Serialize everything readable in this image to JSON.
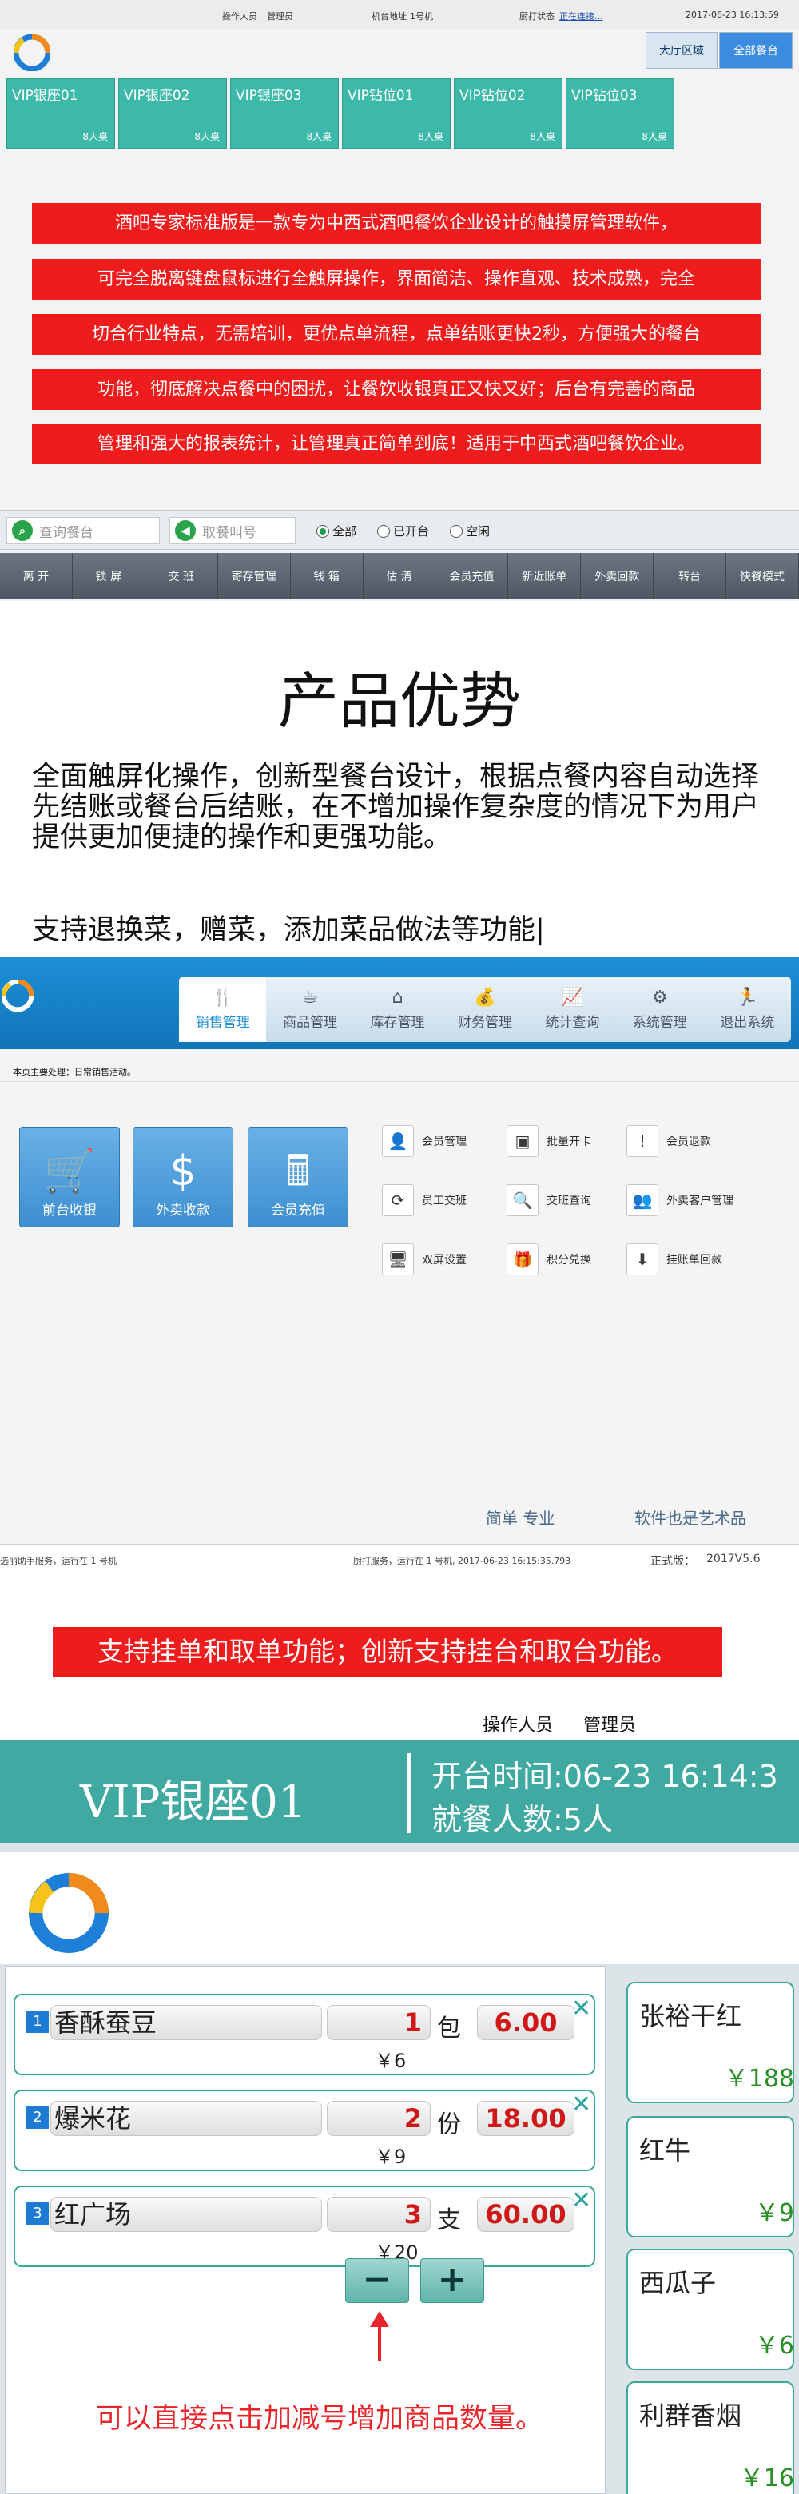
{
  "pos_screen": {
    "status": {
      "operator_label": "操作人员",
      "operator": "管理员",
      "ip_label": "机台地址",
      "ip": "1号机",
      "kitchen_label": "厨打状态",
      "kitchen_status": "正在连接...",
      "datetime": "2017-06-23 16:13:59"
    },
    "area_tabs": [
      "大厅区域",
      "全部餐台"
    ],
    "tables": [
      {
        "name": "VIP银座01",
        "seats": "8人桌"
      },
      {
        "name": "VIP银座02",
        "seats": "8人桌"
      },
      {
        "name": "VIP银座03",
        "seats": "8人桌"
      },
      {
        "name": "VIP钻位01",
        "seats": "8人桌"
      },
      {
        "name": "VIP钻位02",
        "seats": "8人桌"
      },
      {
        "name": "VIP钻位03",
        "seats": "8人桌"
      }
    ],
    "promo_lines": [
      "酒吧专家标准版是一款专为中西式酒吧餐饮企业设计的触摸屏管理软件，",
      "可完全脱离键盘鼠标进行全触屏操作，界面简洁、操作直观、技术成熟，完全",
      "切合行业特点，无需培训，更优点单流程，点单结账更快2秒，方便强大的餐台",
      "功能，彻底解决点餐中的困扰，让餐饮收银真正又快又好；后台有完善的商品",
      "管理和强大的报表统计，让管理真正简单到底！适用于中西式酒吧餐饮企业。"
    ],
    "search_placeholder": "查询餐台",
    "call_placeholder": "取餐叫号",
    "filters": [
      "全部",
      "已开台",
      "空闲"
    ],
    "selected_filter": "全部",
    "function_buttons": [
      "离 开",
      "锁 屏",
      "交 班",
      "寄存管理",
      "钱 箱",
      "估 清",
      "会员充值",
      "新近账单",
      "外卖回款",
      "转台",
      "快餐模式"
    ]
  },
  "advantages": {
    "title": "产品优势",
    "paragraph": "全面触屏化操作，创新型餐台设计，根据点餐内容自动选择先结账或餐台后结账，在不增加操作复杂度的情况下为用户提供更加便捷的操作和更强功能。",
    "extra": "支持退换菜，赠菜，添加菜品做法等功能|"
  },
  "backoffice": {
    "menu": [
      {
        "label": "销售管理",
        "icon": "fork-knife-icon",
        "glyph": "🍴"
      },
      {
        "label": "商品管理",
        "icon": "coffee-icon",
        "glyph": "☕"
      },
      {
        "label": "库存管理",
        "icon": "house-icon",
        "glyph": "⌂"
      },
      {
        "label": "财务管理",
        "icon": "money-bag-icon",
        "glyph": "💰"
      },
      {
        "label": "统计查询",
        "icon": "chart-icon",
        "glyph": "📈"
      },
      {
        "label": "系统管理",
        "icon": "gear-icon",
        "glyph": "⚙"
      },
      {
        "label": "退出系统",
        "icon": "exit-icon",
        "glyph": "🏃"
      }
    ],
    "active_menu": "销售管理",
    "breadcrumb": "本页主要处理：日常销售活动。",
    "big_buttons": [
      {
        "label": "前台收银",
        "icon": "cart-icon",
        "glyph": "🛒"
      },
      {
        "label": "外卖收款",
        "icon": "money-bag-icon",
        "glyph": "$"
      },
      {
        "label": "会员充值",
        "icon": "calculator-icon",
        "glyph": "🖩"
      }
    ],
    "small_items": [
      {
        "label": "会员管理",
        "icon": "member-icon",
        "glyph": "👤"
      },
      {
        "label": "批量开卡",
        "icon": "cards-icon",
        "glyph": "▣"
      },
      {
        "label": "会员退款",
        "icon": "exclamation-icon",
        "glyph": "!"
      },
      {
        "label": "员工交班",
        "icon": "refresh-icon",
        "glyph": "⟳"
      },
      {
        "label": "交班查询",
        "icon": "search-icon",
        "glyph": "🔍"
      },
      {
        "label": "外卖客户管理",
        "icon": "customers-icon",
        "glyph": "👥"
      },
      {
        "label": "双屏设置",
        "icon": "monitor-icon",
        "glyph": "🖥"
      },
      {
        "label": "积分兑换",
        "icon": "gift-icon",
        "glyph": "🎁"
      },
      {
        "label": "挂账单回款",
        "icon": "download-icon",
        "glyph": "⬇"
      }
    ],
    "slogan_left": "简单  专业",
    "slogan_right": "软件也是艺术品",
    "footer": {
      "left": "选丽助手服务，运行在 1 号机",
      "middle": "厨打服务，运行在 1 号机, 2017-06-23 16:15:35.793",
      "version_label": "正式版：",
      "version": "2017V5.6"
    }
  },
  "banner2": "支持挂单和取单功能；创新支持挂台和取台功能。",
  "order_screen": {
    "operator_label": "操作人员",
    "operator": "管理员",
    "table_name": "VIP银座01",
    "open_time": "开台时间:06-23 16:14:3",
    "diners": "就餐人数:5人",
    "items": [
      {
        "no": "1",
        "name": "香酥蚕豆",
        "qty": "1",
        "unit": "包",
        "price": "6.00",
        "subtotal": "￥6"
      },
      {
        "no": "2",
        "name": "爆米花",
        "qty": "2",
        "unit": "份",
        "price": "18.00",
        "subtotal": "￥9"
      },
      {
        "no": "3",
        "name": "红广场",
        "qty": "3",
        "unit": "支",
        "price": "60.00",
        "subtotal": "￥20"
      }
    ],
    "minus": "−",
    "plus": "+",
    "note": "可以直接点击加减号增加商品数量。",
    "products": [
      {
        "name": "张裕干红",
        "price": "￥188"
      },
      {
        "name": "红牛",
        "price": "￥9"
      },
      {
        "name": "西瓜子",
        "price": "￥6"
      },
      {
        "name": "利群香烟",
        "price": "￥16"
      }
    ]
  },
  "colors": {
    "teal": "#3cb9a8",
    "red": "#ee1c1c",
    "blue": "#1e8fd6"
  }
}
